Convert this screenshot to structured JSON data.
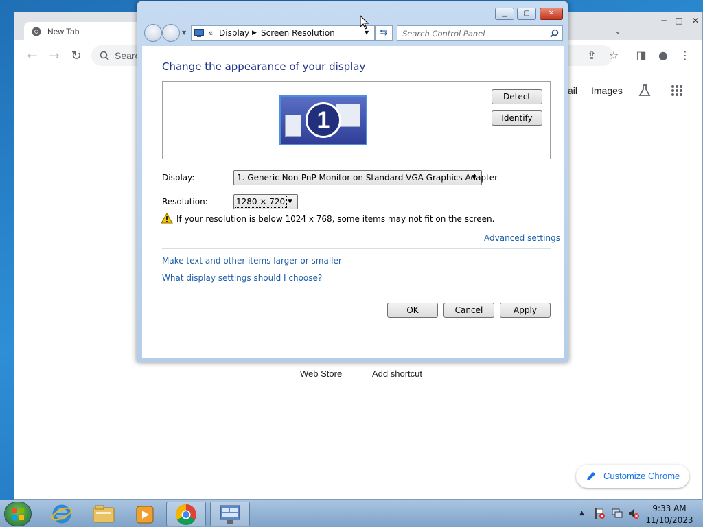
{
  "chrome": {
    "tab_title": "New Tab",
    "omnibox_placeholder": "Search",
    "ntp_links": [
      "ail",
      "Images"
    ],
    "shortcuts": [
      "Web Store",
      "Add shortcut"
    ],
    "customize_label": "Customize Chrome"
  },
  "dialog": {
    "breadcrumb": [
      "Display",
      "Screen Resolution"
    ],
    "breadcrumb_prefix": "«",
    "search_placeholder": "Search Control Panel",
    "heading": "Change the appearance of your display",
    "monitor_number": "1",
    "detect_label": "Detect",
    "identify_label": "Identify",
    "display_label": "Display:",
    "display_value": "1. Generic Non-PnP Monitor on Standard VGA Graphics Adapter",
    "resolution_label": "Resolution:",
    "resolution_value": "1280 × 720",
    "warning_text": "If your resolution is below 1024 x 768, some items may not fit on the screen.",
    "advanced_link": "Advanced settings",
    "link_text_size": "Make text and other items larger or smaller",
    "link_help": "What display settings should I choose?",
    "ok_label": "OK",
    "cancel_label": "Cancel",
    "apply_label": "Apply"
  },
  "taskbar": {
    "time": "9:33 AM",
    "date": "11/10/2023",
    "pinned": [
      "internet-explorer",
      "file-explorer",
      "media-player",
      "chrome",
      "control-panel"
    ]
  },
  "colors": {
    "dialog_heading": "#1e3287",
    "link": "#1e5fa9",
    "chrome_accent": "#1a73e8"
  }
}
